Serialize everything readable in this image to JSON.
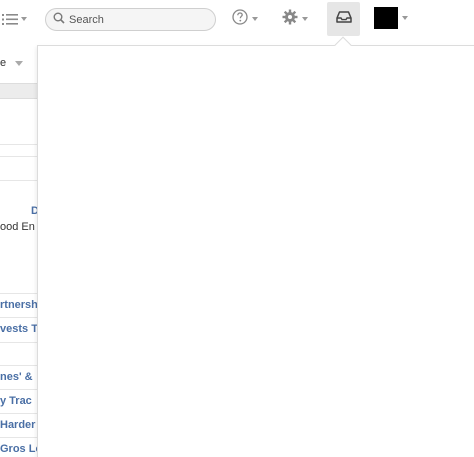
{
  "topbar": {
    "search_placeholder": "Search"
  },
  "icons": {
    "menu": "list-menu-icon",
    "search": "search-icon",
    "help": "help-circle-icon",
    "settings": "gear-icon",
    "inbox": "inbox-tray-icon"
  },
  "colors": {
    "link": "#4a6fa5",
    "inbox_active_bg": "#e6e6e6",
    "avatar": "#000000"
  },
  "left_panel": {
    "filter_label": "e",
    "header_letter": "D",
    "row1_text": "ood En",
    "items": [
      "rtnersh",
      "vests T",
      "nes' &",
      "y Trac",
      "Harder",
      "Gros Lo"
    ]
  }
}
